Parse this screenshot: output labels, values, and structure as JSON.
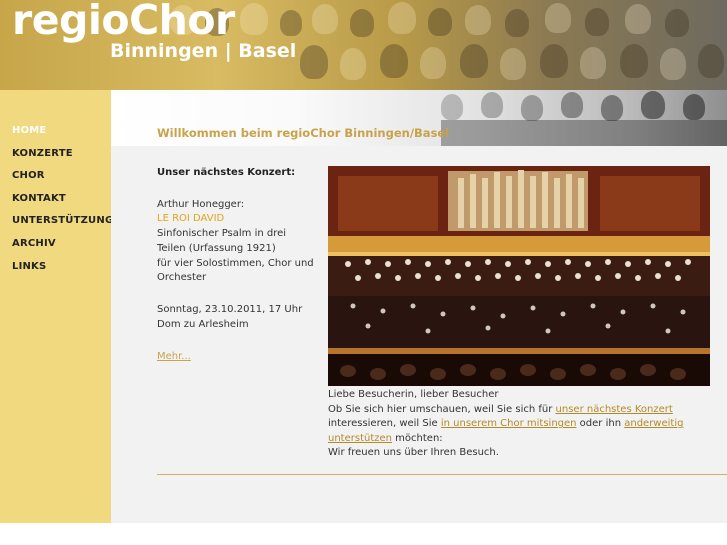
{
  "header": {
    "logo_title": "regioChor",
    "logo_subtitle": "Binningen | Basel"
  },
  "nav": {
    "items": [
      {
        "label": "HOME",
        "active": true
      },
      {
        "label": "KONZERTE"
      },
      {
        "label": "CHOR"
      },
      {
        "label": "KONTAKT"
      },
      {
        "label": "UNTERSTÜTZUNG"
      },
      {
        "label": "ARCHIV"
      },
      {
        "label": "LINKS"
      }
    ]
  },
  "welcome_title": "Willkommen beim regioChor Binningen/Basel",
  "concert": {
    "heading": "Unser nächstes Konzert:",
    "composer": "Arthur Honegger:",
    "work_title": "LE ROI DAVID",
    "description_1": "Sinfonischer Psalm in drei Teilen (Urfassung 1921)",
    "description_2": "für vier Solostimmen, Chor und Orchester",
    "date": "Sonntag, 23.10.2011, 17 Uhr",
    "venue": "Dom zu Arlesheim",
    "more_link": "Mehr..."
  },
  "greeting": {
    "line1": "Liebe Besucherin, lieber Besucher",
    "line2_a": "Ob Sie sich hier umschauen, weil Sie sich für ",
    "link_concert": "unser nächstes Konzert",
    "line2_b": " interessieren, weil Sie ",
    "link_sing": "in unserem Chor mitsingen",
    "line2_c": " oder ihn ",
    "link_support": "anderweitig unterstützen",
    "line2_d": " möchten:",
    "line3": "Wir freuen uns über Ihren Besuch."
  },
  "colors": {
    "sidebar": "#f1d97f",
    "accent": "#c8a34a",
    "work_title": "#e0a41c"
  },
  "icons": {
    "photo": "concert-hall-photo"
  }
}
